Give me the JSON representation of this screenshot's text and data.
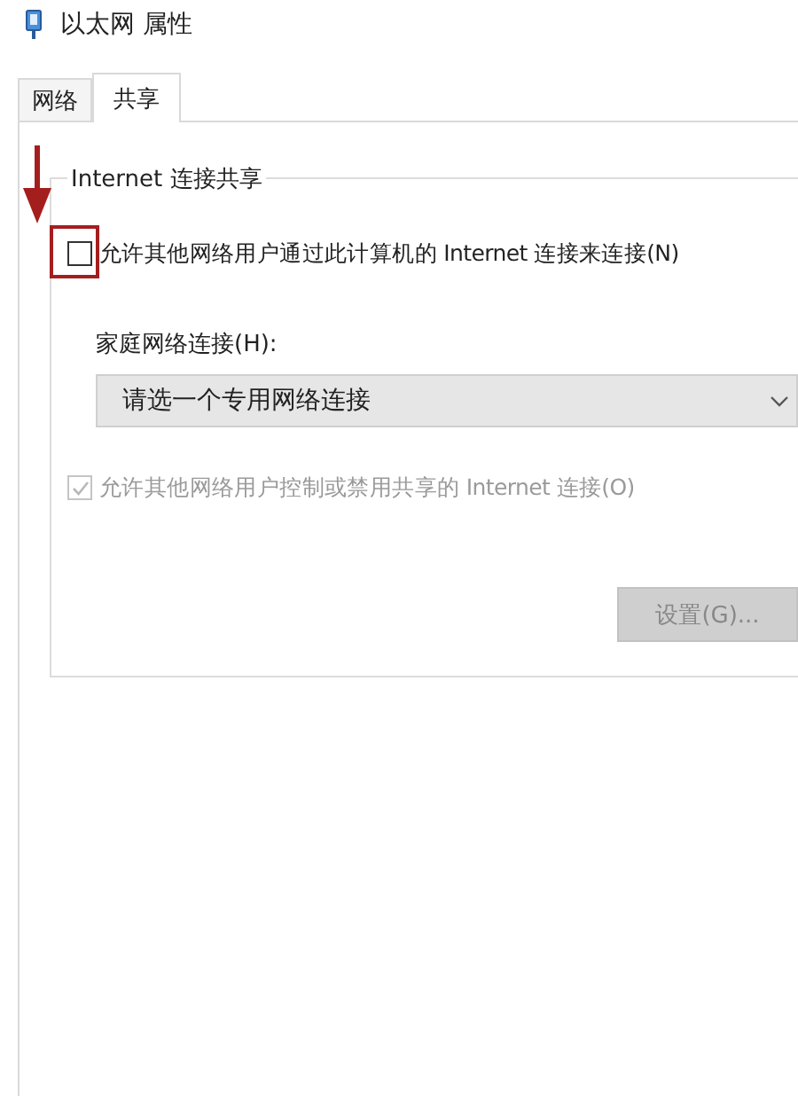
{
  "window": {
    "title": "以太网 属性"
  },
  "tabs": [
    {
      "label": "网络",
      "selected": false
    },
    {
      "label": "共享",
      "selected": true
    }
  ],
  "group": {
    "title": "Internet 连接共享",
    "options": [
      {
        "kind": "checkbox",
        "label": "允许其他网络用户通过此计算机的 Internet 连接来连接(N)",
        "checked": false,
        "disabled": false,
        "highlighted": true
      },
      {
        "kind": "dropdown",
        "label": "家庭网络连接(H):",
        "value": "请选一个专用网络连接"
      },
      {
        "kind": "checkbox",
        "label": "允许其他网络用户控制或禁用共享的 Internet 连接(O)",
        "checked": true,
        "disabled": true,
        "highlighted": false
      }
    ],
    "button": {
      "label": "设置(G)...",
      "disabled": true
    }
  }
}
